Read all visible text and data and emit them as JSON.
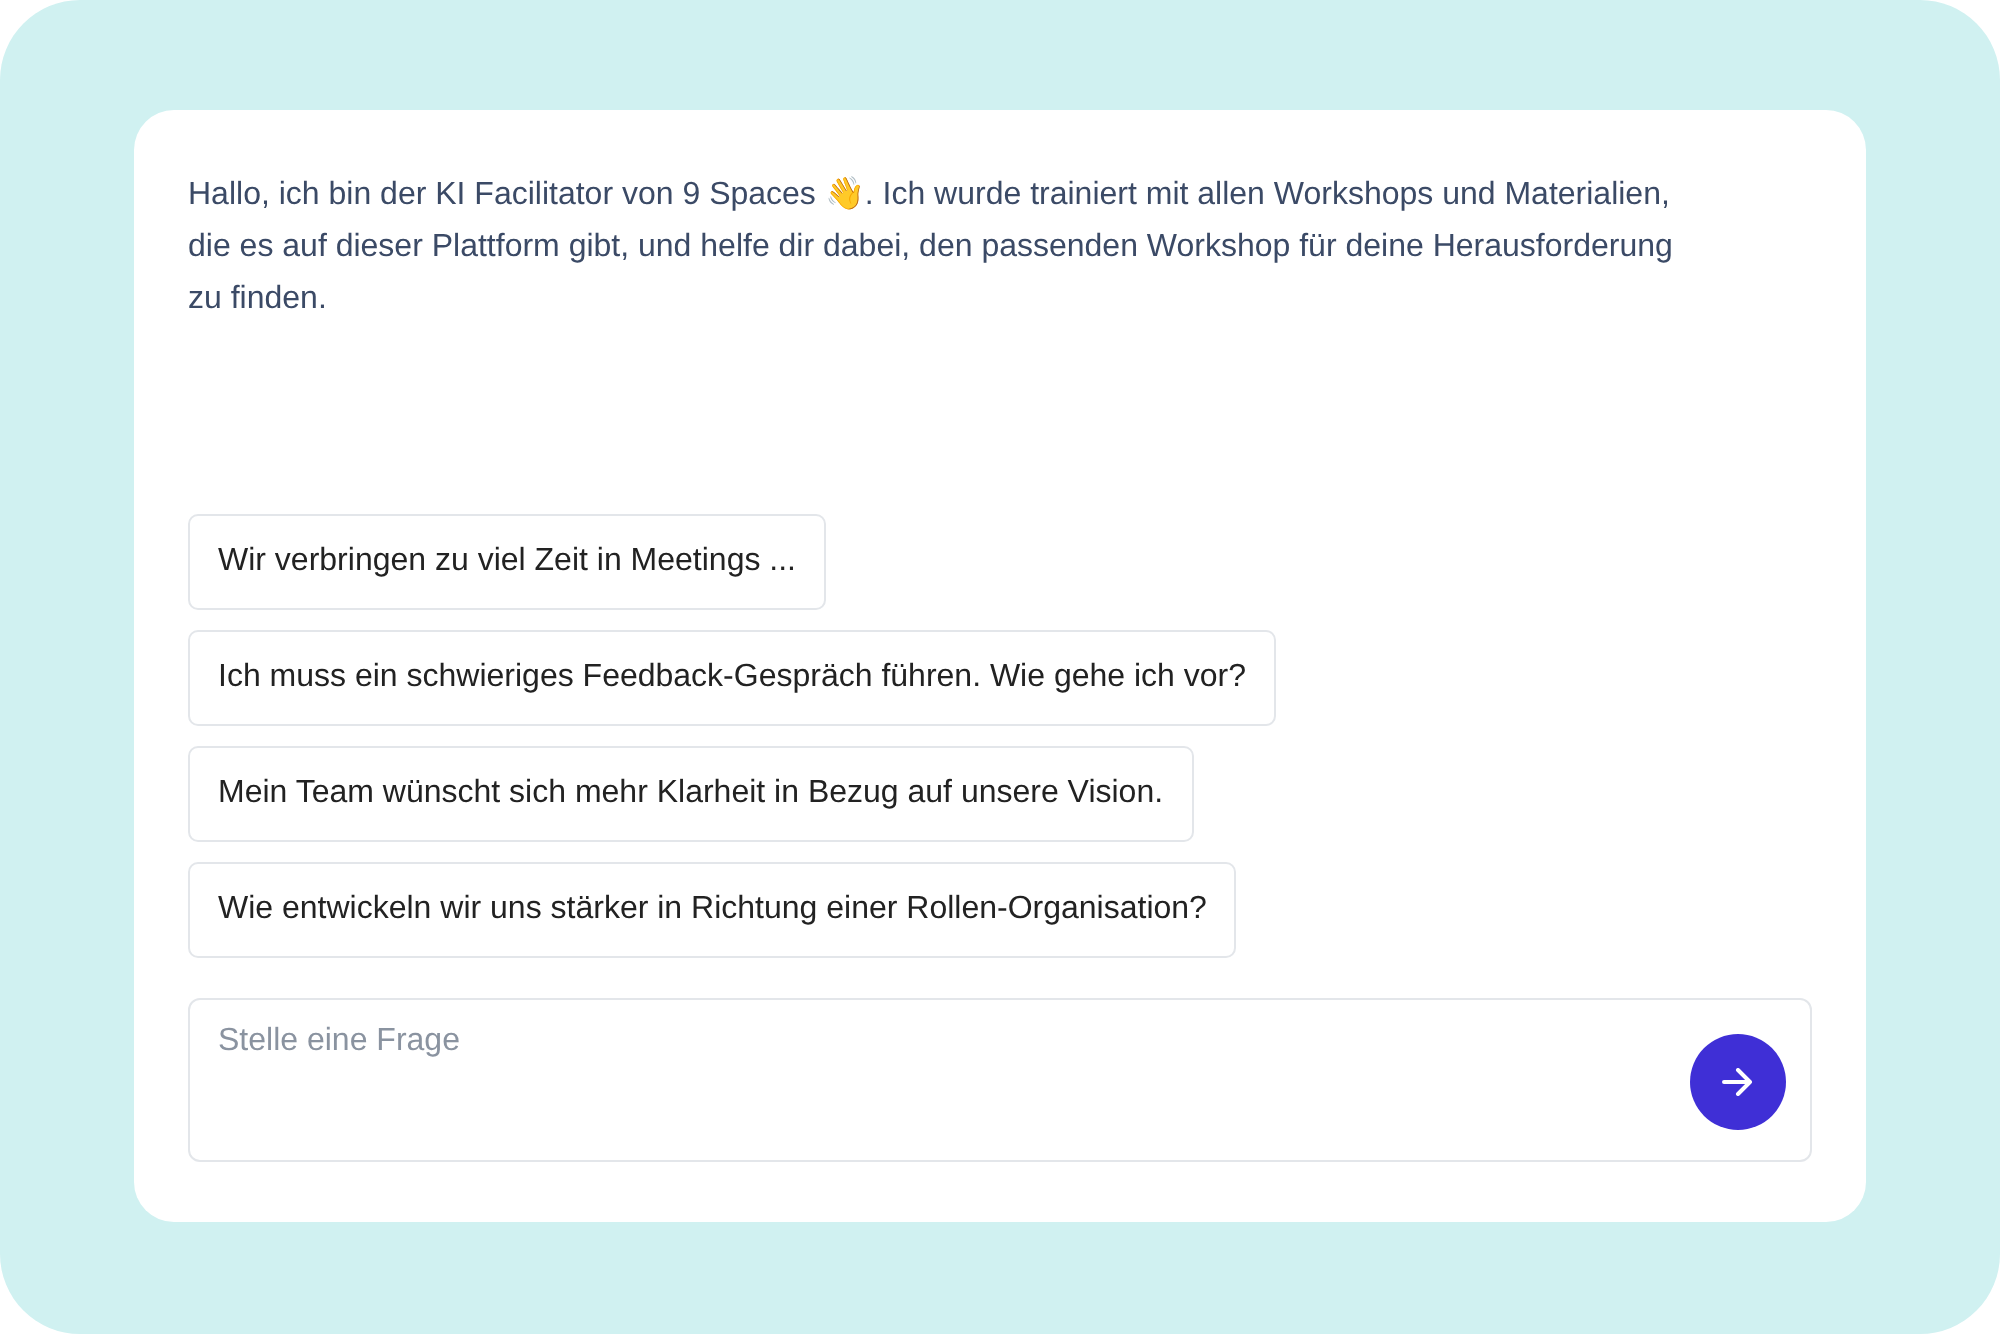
{
  "intro": "Hallo, ich bin der KI Facilitator von 9 Spaces 👋. Ich wurde trainiert mit allen Workshops und Materialien, die es auf dieser Plattform gibt, und helfe dir dabei, den passenden Workshop für deine Herausforderung zu finden.",
  "suggestions": [
    "Wir verbringen zu viel Zeit in Meetings ...",
    "Ich muss ein schwieriges Feedback-Gespräch führen. Wie gehe ich vor?",
    "Mein Team wünscht sich mehr Klarheit in Bezug auf unsere Vision.",
    "Wie entwickeln wir uns stärker in Richtung einer Rollen-Organisation?"
  ],
  "question_field": {
    "placeholder": "Stelle eine Frage"
  }
}
